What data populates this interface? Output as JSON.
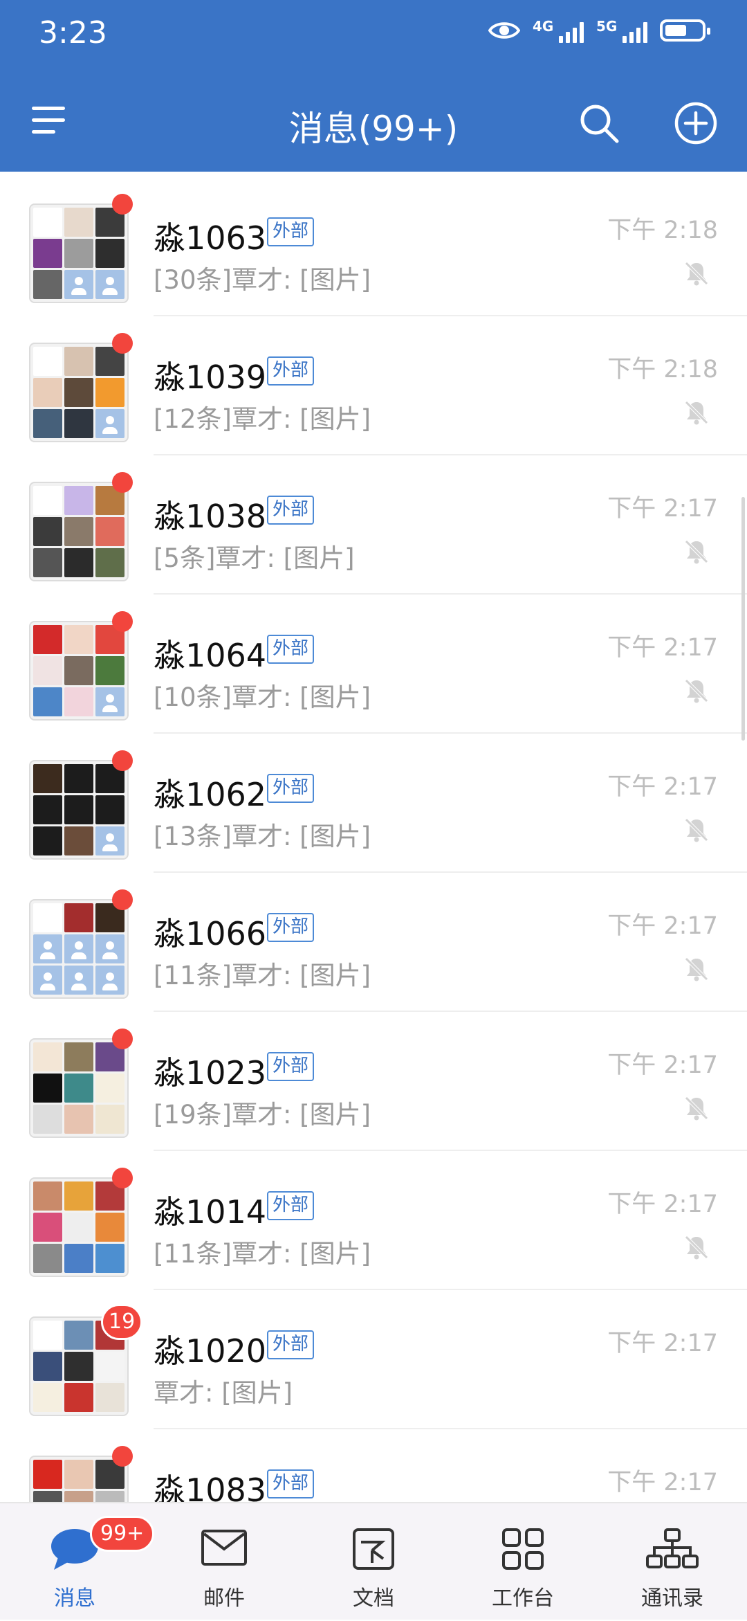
{
  "status_bar": {
    "time": "3:23",
    "icons": [
      "eye-icon",
      "signal-4g-icon",
      "signal-5g-icon",
      "battery-icon"
    ],
    "net1": "4G",
    "net2": "5G"
  },
  "header": {
    "title": "消息(99+)",
    "left_icon": "menu-icon",
    "right_icons": [
      "search-icon",
      "add-icon"
    ],
    "background": "#3A74C6"
  },
  "conversations": [
    {
      "name": "淼1063",
      "tag": "外部",
      "preview": "[30条]覃才: [图片]",
      "time": "下午 2:18",
      "muted": true,
      "badge": ""
    },
    {
      "name": "淼1039",
      "tag": "外部",
      "preview": "[12条]覃才: [图片]",
      "time": "下午 2:18",
      "muted": true,
      "badge": ""
    },
    {
      "name": "淼1038",
      "tag": "外部",
      "preview": "[5条]覃才: [图片]",
      "time": "下午 2:17",
      "muted": true,
      "badge": ""
    },
    {
      "name": "淼1064",
      "tag": "外部",
      "preview": "[10条]覃才: [图片]",
      "time": "下午 2:17",
      "muted": true,
      "badge": ""
    },
    {
      "name": "淼1062",
      "tag": "外部",
      "preview": "[13条]覃才: [图片]",
      "time": "下午 2:17",
      "muted": true,
      "badge": ""
    },
    {
      "name": "淼1066",
      "tag": "外部",
      "preview": "[11条]覃才: [图片]",
      "time": "下午 2:17",
      "muted": true,
      "badge": ""
    },
    {
      "name": "淼1023",
      "tag": "外部",
      "preview": "[19条]覃才: [图片]",
      "time": "下午 2:17",
      "muted": true,
      "badge": ""
    },
    {
      "name": "淼1014",
      "tag": "外部",
      "preview": "[11条]覃才: [图片]",
      "time": "下午 2:17",
      "muted": true,
      "badge": ""
    },
    {
      "name": "淼1020",
      "tag": "外部",
      "preview": "覃才: [图片]",
      "time": "下午 2:17",
      "muted": false,
      "badge": "19"
    },
    {
      "name": "淼1083",
      "tag": "外部",
      "preview": "",
      "time": "下午 2:17",
      "muted": false,
      "badge": ""
    }
  ],
  "tab_bar": {
    "tabs": [
      {
        "label": "消息",
        "icon": "chat-bubble-icon",
        "badge": "99+",
        "active": true
      },
      {
        "label": "邮件",
        "icon": "mail-icon",
        "badge": "",
        "active": false
      },
      {
        "label": "文档",
        "icon": "document-icon",
        "badge": "",
        "active": false
      },
      {
        "label": "工作台",
        "icon": "grid-icon",
        "badge": "",
        "active": false
      },
      {
        "label": "通讯录",
        "icon": "org-chart-icon",
        "badge": "",
        "active": false
      }
    ]
  },
  "colors": {
    "brand_blue": "#3A74C6",
    "badge_red": "#F2453D",
    "tag_blue": "#3A74C6",
    "secondary_text": "#9A9A9A",
    "active_tab": "#2F6FCF"
  }
}
